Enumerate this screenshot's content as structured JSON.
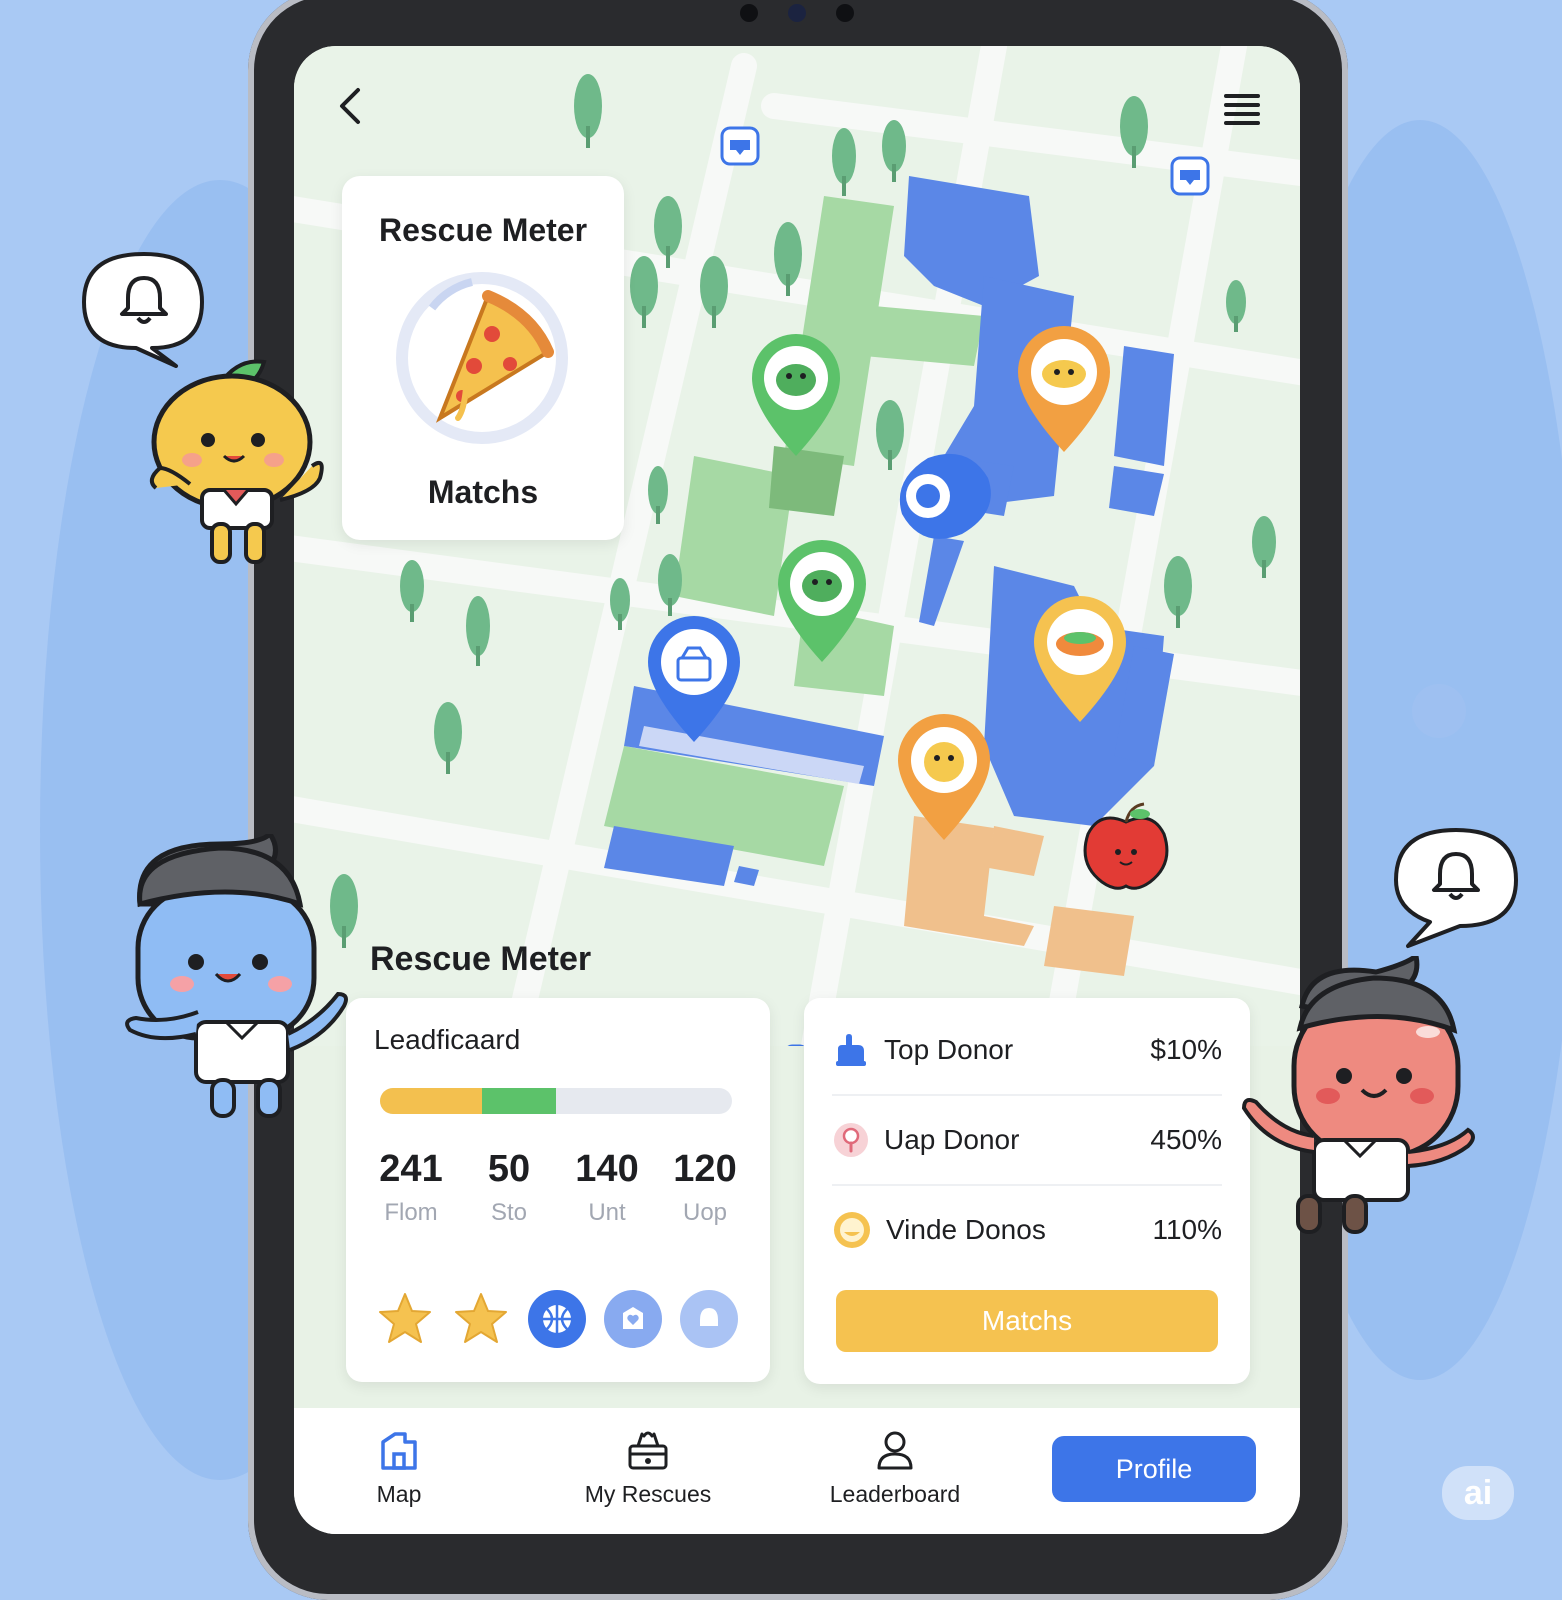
{
  "nav_header": {
    "back_icon": "chevron-left-icon",
    "menu_icon": "hamburger-menu-icon"
  },
  "rescue_meter_card": {
    "title": "Rescue Meter",
    "label": "Matchs",
    "icon": "pizza-slice-icon"
  },
  "section_title": "Rescue Meter",
  "leaderboard": {
    "title": "Leadficaard",
    "progress_segments": [
      {
        "fraction": 0.29,
        "color": "#f3c04f"
      },
      {
        "fraction": 0.21,
        "color": "#5cc26a"
      }
    ],
    "stats": [
      {
        "value": "241",
        "label": "Flom"
      },
      {
        "value": "50",
        "label": "Sto"
      },
      {
        "value": "140",
        "label": "Unt"
      },
      {
        "value": "120",
        "label": "Uop"
      }
    ],
    "badges": [
      "star-badge-icon",
      "star-badge-icon",
      "basketball-badge-icon",
      "heart-badge-icon",
      "bell-badge-icon"
    ]
  },
  "donors": {
    "rows": [
      {
        "name": "Top Donor",
        "value": "$10%",
        "icon": "hand-icon"
      },
      {
        "name": "Uap Donor",
        "value": "450%",
        "icon": "alert-icon"
      },
      {
        "name": "Vinde Donos",
        "value": "110%",
        "icon": "gold-coin-icon"
      }
    ],
    "button_label": "Matchs"
  },
  "bottom_nav": {
    "items": [
      {
        "label": "Map",
        "icon": "house-icon"
      },
      {
        "label": "My Rescues",
        "icon": "gift-basket-icon"
      },
      {
        "label": "Leaderboard",
        "icon": "user-icon"
      }
    ],
    "profile_label": "Profile"
  },
  "watermark": "ai",
  "colors": {
    "accent_blue": "#3d75e8",
    "accent_yellow": "#f5c250",
    "accent_green": "#5cc26a",
    "building_blue": "#5a86e6",
    "park_green": "#9ed39c",
    "background": "#a9c9f4"
  }
}
